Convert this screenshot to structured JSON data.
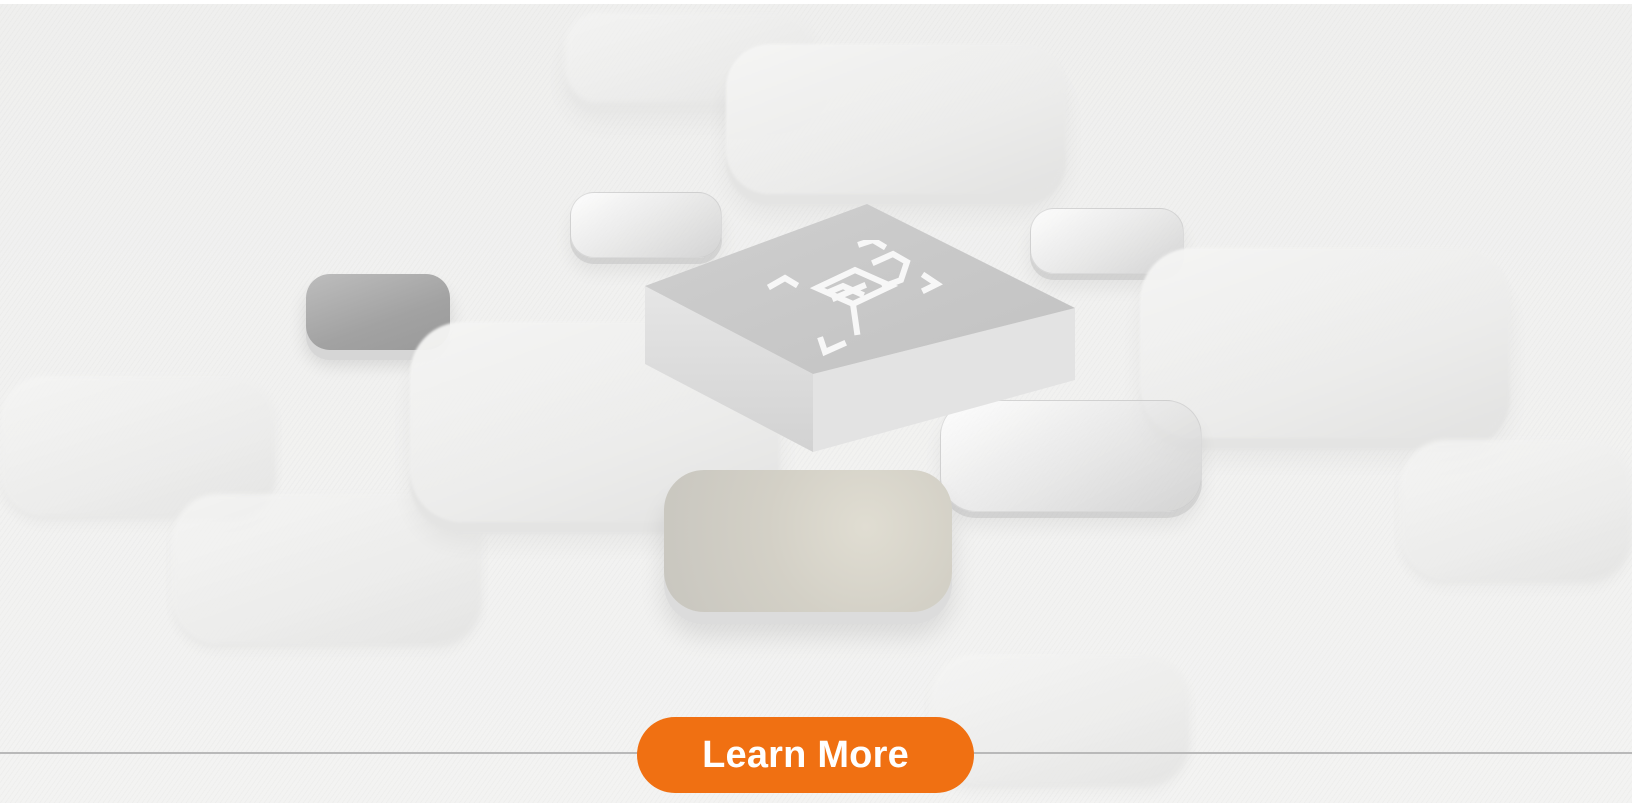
{
  "hero": {
    "image_icon": "scan-document-icon",
    "cta_label": "Learn More"
  },
  "colors": {
    "accent": "#f07012",
    "divider": "#b9b9b9",
    "background": "#f0f0ef"
  }
}
